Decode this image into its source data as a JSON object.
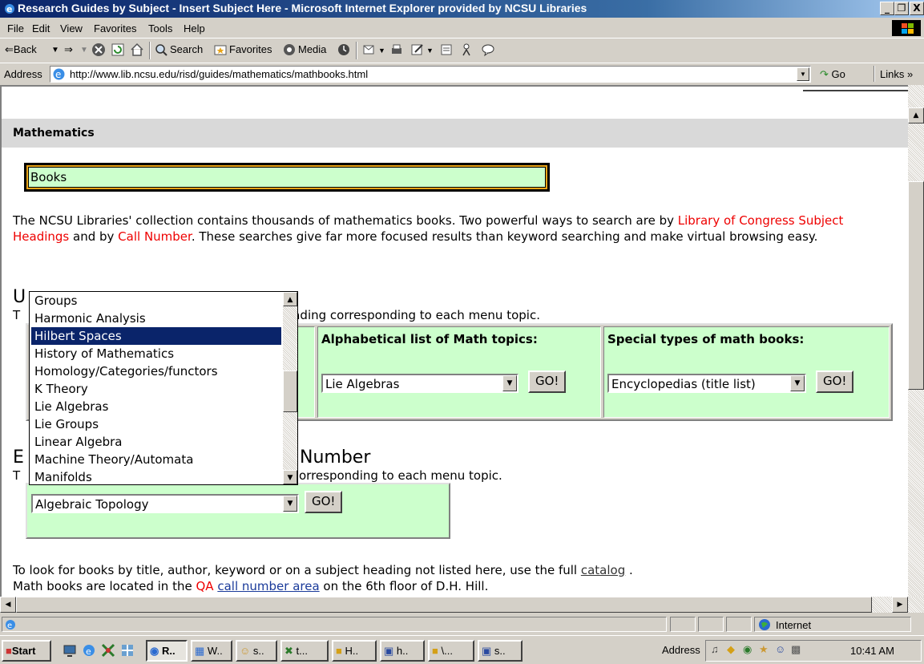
{
  "window": {
    "title": "Research Guides by Subject - Insert Subject Here - Microsoft Internet Explorer provided by NCSU Libraries",
    "controls": [
      "_",
      "ő",
      "X"
    ]
  },
  "menu": [
    "File",
    "Edit",
    "View",
    "Favorites",
    "Tools",
    "Help"
  ],
  "toolbar": {
    "back": "⇐Back",
    "search": "Search",
    "favorites": "Favorites",
    "media": "Media"
  },
  "address": {
    "label": "Address",
    "url": "http://www.lib.ncsu.edu/risd/guides/mathematics/mathbooks.html",
    "go": "Go",
    "links": "Links »"
  },
  "page": {
    "subject": "Mathematics",
    "section_title": "Books",
    "intro_parts": [
      "The NCSU Libraries' collection contains thousands of mathematics books. Two powerful ways to search are by ",
      "Library of Congress Subject Headings",
      " and by ",
      "Call Number",
      ". These searches give far more focused results than keyword searching and make virtual browsing easy."
    ],
    "lcsh": {
      "heading_visible": "U",
      "sub_visible": "T",
      "sub_tail": "eading corresponding to each menu topic.",
      "col2_header": "Alphabetical list of Math topics:",
      "col2_value": "Lie Algebras",
      "col3_header": "Special types of math books:",
      "col3_value": "Encyclopedias (title list)",
      "go": "GO!"
    },
    "callnum": {
      "heading_visible": "E",
      "heading_tail": "Number",
      "sub_visible": "T",
      "sub_tail": "orresponding to each menu topic.",
      "value": "Algebraic Topology",
      "go": "GO!"
    },
    "foot1_pre": "To look for books by title, author, keyword or on a subject heading not listed here, use the full ",
    "foot1_link": "catalog",
    "foot1_post": " .",
    "foot2_pre": "Math books are located in the ",
    "foot2_qa": "QA",
    "foot2_mid": " ",
    "foot2_link": "call number area",
    "foot2_post": " on the 6th floor of D.H. Hill."
  },
  "dropdown": {
    "items": [
      "Groups",
      "Harmonic Analysis",
      "Hilbert Spaces",
      "History of Mathematics",
      "Homology/Categories/functors",
      "K Theory",
      "Lie Algebras",
      "Lie Groups",
      "Linear Algebra",
      "Machine Theory/Automata",
      "Manifolds"
    ],
    "highlighted": "Hilbert Spaces"
  },
  "status": {
    "zone": "Internet"
  },
  "taskbar": {
    "start": "Start",
    "tasks": [
      "R..",
      "W..",
      "s..",
      "t...",
      "H..",
      "h..",
      "\\...",
      "s.."
    ],
    "address": "Address",
    "clock": "10:41 AM"
  }
}
